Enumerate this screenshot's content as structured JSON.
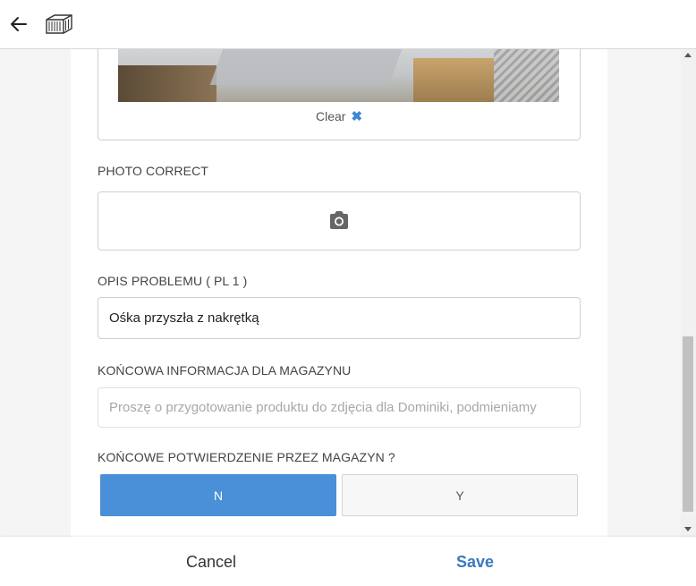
{
  "header": {
    "back_icon": "arrow-left-icon",
    "app_icon": "shipping-container-icon"
  },
  "photo": {
    "clear_label": "Clear",
    "clear_icon": "✖"
  },
  "fields": {
    "photo_correct": {
      "label": "PHOTO CORRECT",
      "icon": "camera-icon"
    },
    "problem_description": {
      "label": "OPIS PROBLEMU ( PL 1 )",
      "value": "Ośka przyszła z nakrętką"
    },
    "final_info": {
      "label": "KOŃCOWA INFORMACJA DLA MAGAZYNU",
      "placeholder": "Proszę o przygotowanie produktu do zdjęcia dla Dominiki, podmieniamy"
    },
    "final_confirmation": {
      "label": "KOŃCOWE POTWIERDZENIE PRZEZ MAGAZYN ?",
      "options": [
        "N",
        "Y"
      ],
      "selected": "N"
    }
  },
  "footer": {
    "cancel_label": "Cancel",
    "save_label": "Save"
  },
  "colors": {
    "accent": "#4a90d9",
    "save_text": "#3a78c2",
    "clear_icon": "#3f86d1"
  }
}
